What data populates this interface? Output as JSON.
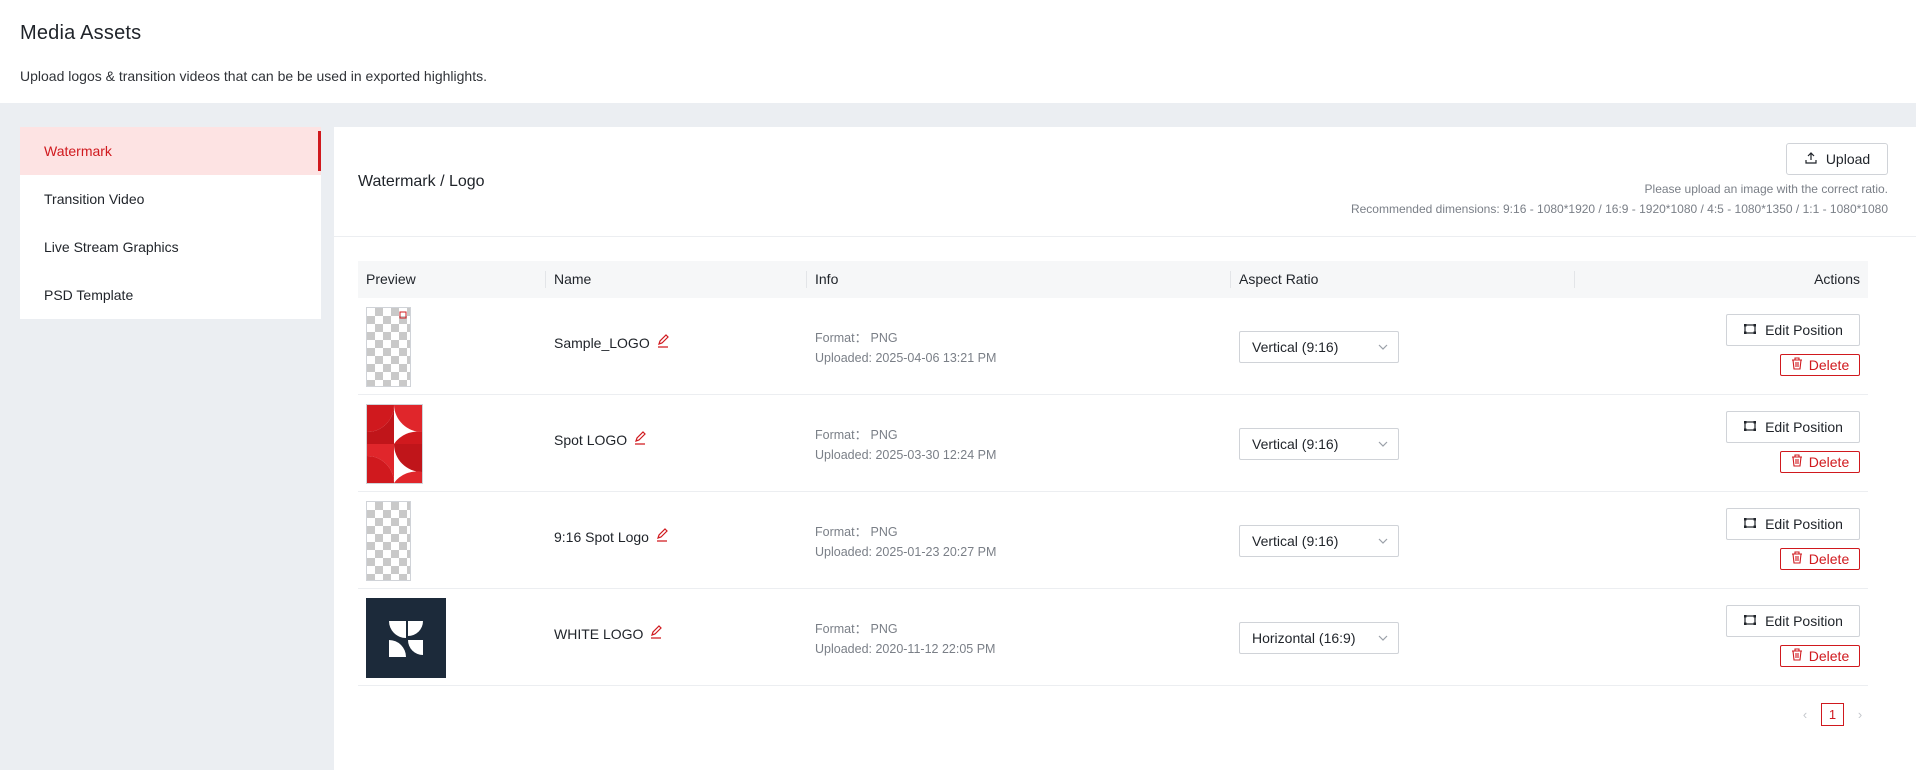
{
  "page": {
    "title": "Media Assets",
    "description": "Upload logos & transition videos that can be be used in exported highlights."
  },
  "sidebar": {
    "items": [
      {
        "label": "Watermark",
        "active": true
      },
      {
        "label": "Transition Video",
        "active": false
      },
      {
        "label": "Live Stream Graphics",
        "active": false
      },
      {
        "label": "PSD Template",
        "active": false
      }
    ]
  },
  "panel": {
    "title": "Watermark / Logo",
    "upload_label": "Upload",
    "hint_line1": "Please upload an image with the correct ratio.",
    "hint_line2": "Recommended dimensions: 9:16 - 1080*1920 / 16:9 - 1920*1080 / 4:5 - 1080*1350 / 1:1 - 1080*1080"
  },
  "table": {
    "columns": [
      "Preview",
      "Name",
      "Info",
      "Aspect Ratio",
      "Actions"
    ],
    "rows": [
      {
        "name": "Sample_LOGO",
        "format": "Format： PNG",
        "uploaded": "Uploaded: 2025-04-06 13:21 PM",
        "aspect": "Vertical (9:16)",
        "edit_label": "Edit Position",
        "delete_label": "Delete",
        "preview": "checker-portrait"
      },
      {
        "name": "Spot LOGO",
        "format": "Format： PNG",
        "uploaded": "Uploaded: 2025-03-30 12:24 PM",
        "aspect": "Vertical (9:16)",
        "edit_label": "Edit Position",
        "delete_label": "Delete",
        "preview": "red-logo"
      },
      {
        "name": "9:16 Spot Logo",
        "format": "Format： PNG",
        "uploaded": "Uploaded: 2025-01-23 20:27 PM",
        "aspect": "Vertical (9:16)",
        "edit_label": "Edit Position",
        "delete_label": "Delete",
        "preview": "checker-portrait"
      },
      {
        "name": "WHITE LOGO",
        "format": "Format： PNG",
        "uploaded": "Uploaded: 2020-11-12 22:05 PM",
        "aspect": "Horizontal (16:9)",
        "edit_label": "Edit Position",
        "delete_label": "Delete",
        "preview": "white-logo-dark"
      }
    ]
  },
  "pagination": {
    "current": "1"
  },
  "colors": {
    "accent": "#d0191e",
    "active_bg": "#fde3e3",
    "navy": "#1c2a3a"
  }
}
